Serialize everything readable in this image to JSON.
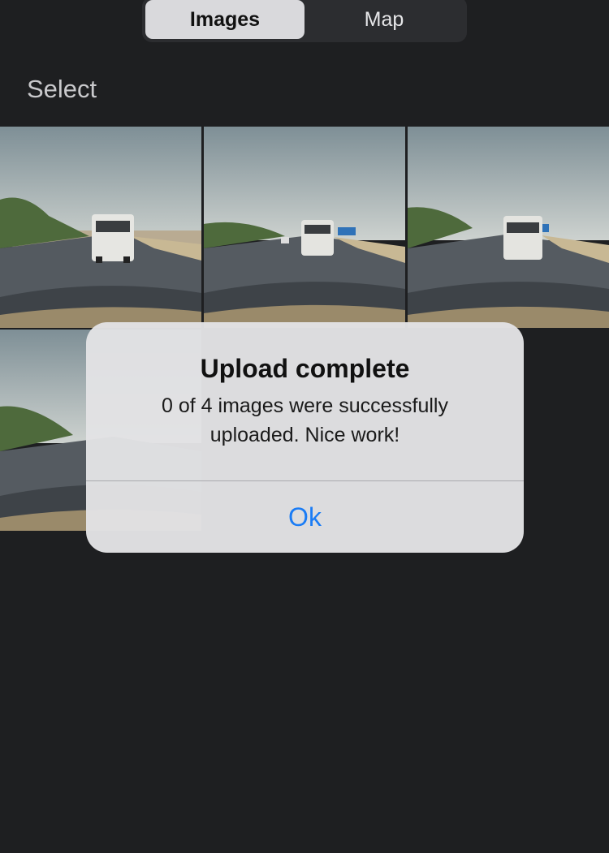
{
  "segmented": {
    "items": [
      {
        "label": "Images",
        "active": true
      },
      {
        "label": "Map",
        "active": false
      }
    ]
  },
  "select_label": "Select",
  "photos": [
    {
      "icon": "road-photo-thumbnail"
    },
    {
      "icon": "road-photo-thumbnail"
    },
    {
      "icon": "road-photo-thumbnail"
    },
    {
      "icon": "road-photo-thumbnail"
    }
  ],
  "alert": {
    "title": "Upload complete",
    "message": "0 of 4 images were successfully uploaded. Nice work!",
    "ok_label": "Ok"
  },
  "colors": {
    "background": "#1e1f21",
    "accent": "#1a7cf5",
    "alert_bg": "#e2e2e4"
  }
}
